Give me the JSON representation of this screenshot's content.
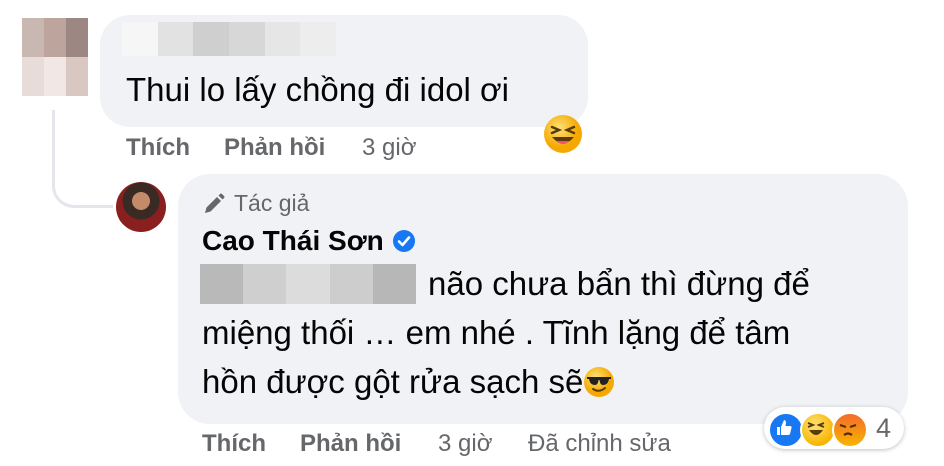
{
  "colors": {
    "bubble": "#f0f2f5",
    "meta_text": "#65676b",
    "verified": "#1877f2",
    "like": "#1877f2"
  },
  "comment": {
    "text": "Thui lo lấy chồng đi idol ơi",
    "emoji_reaction": "laughing-emoji",
    "actions": {
      "like": "Thích",
      "reply": "Phản hồi",
      "time": "3 giờ"
    }
  },
  "reply": {
    "badge_icon": "pencil-icon",
    "badge": "Tác giả",
    "author": "Cao Thái Sơn",
    "verified_icon": "verified-badge-icon",
    "line1": "não chưa bẩn thì đừng để",
    "line2": "miệng thối … em nhé . Tĩnh lặng để tâm",
    "line3": "hồn được gột rửa sạch sẽ",
    "trailing_emoji": "sunglasses-emoji",
    "actions": {
      "like": "Thích",
      "reply": "Phản hồi",
      "time": "3 giờ",
      "edited": "Đã chỉnh sửa"
    },
    "reactions": {
      "icons": [
        "like-icon",
        "haha-icon",
        "angry-icon"
      ],
      "count": "4"
    }
  }
}
